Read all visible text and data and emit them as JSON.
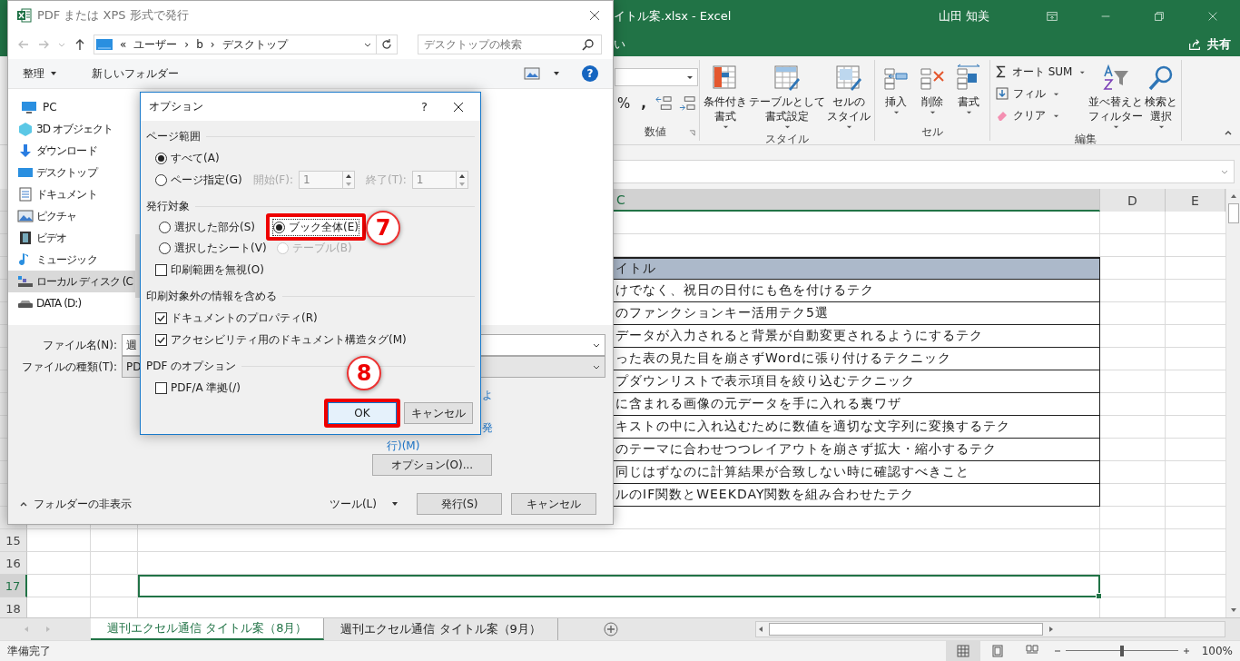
{
  "excel": {
    "title": "イトル案.xlsx  -  Excel",
    "user": "山田 知美",
    "tab_fragment": "い",
    "share": "共有",
    "ribbon": {
      "number_group": {
        "label": "数値",
        "percent": "%",
        "comma": ","
      },
      "style_group": {
        "label": "スタイル",
        "buttons": [
          {
            "lines": [
              "条件付き",
              "書式"
            ]
          },
          {
            "lines": [
              "テーブルとして",
              "書式設定"
            ]
          },
          {
            "lines": [
              "セルの",
              "スタイル"
            ]
          }
        ]
      },
      "cells_group": {
        "label": "セル",
        "buttons": [
          {
            "label": "挿入"
          },
          {
            "label": "削除"
          },
          {
            "label": "書式"
          }
        ]
      },
      "edit_group": {
        "label": "編集",
        "small_buttons": [
          {
            "label": "オート SUM"
          },
          {
            "label": "フィル"
          },
          {
            "label": "クリア"
          }
        ],
        "buttons": [
          {
            "lines": [
              "並べ替えと",
              "フィルター"
            ]
          },
          {
            "lines": [
              "検索と",
              "選択"
            ]
          }
        ]
      }
    },
    "columns": [
      {
        "label": "C",
        "selected": true
      },
      {
        "label": "D",
        "selected": false
      },
      {
        "label": "E",
        "selected": false
      }
    ],
    "rows": [
      {
        "kind": "blank",
        "selected": false
      },
      {
        "kind": "blank",
        "selected": false
      },
      {
        "kind": "header",
        "c": "イトル",
        "selected": false
      },
      {
        "kind": "data",
        "c": "けでなく、祝日の日付にも色を付けるテク",
        "selected": false
      },
      {
        "kind": "data",
        "c": "のファンクションキー活用テク5選",
        "selected": false
      },
      {
        "kind": "data",
        "c": "データが入力されると背景が自動変更されるようにするテク",
        "selected": false
      },
      {
        "kind": "data",
        "c": "った表の見た目を崩さずWordに張り付けるテクニック",
        "selected": false
      },
      {
        "kind": "data",
        "c": "プダウンリストで表示項目を絞り込むテクニック",
        "selected": false
      },
      {
        "kind": "data",
        "c": "に含まれる画像の元データを手に入れる裏ワザ",
        "selected": false
      },
      {
        "kind": "data",
        "c": "キストの中に入れ込むために数値を適切な文字列に変換するテク",
        "selected": false
      },
      {
        "kind": "data",
        "c": "のテーマに合わせつつレイアウトを崩さず拡大・縮小するテク",
        "selected": false
      },
      {
        "kind": "data",
        "c": "同じはずなのに計算結果が合致しない時に確認すべきこと",
        "selected": false
      },
      {
        "kind": "data",
        "c": "ルのIF関数とWEEKDAY関数を組み合わせたテク",
        "selected": false
      },
      {
        "kind": "blank",
        "selected": false
      },
      {
        "kind": "blank",
        "number": "15",
        "selected": false
      },
      {
        "kind": "blank",
        "number": "16",
        "selected": false
      },
      {
        "kind": "blank",
        "number": "17",
        "selected": true
      },
      {
        "kind": "blank",
        "number": "18",
        "selected": false
      }
    ],
    "sheet_tabs": [
      {
        "label": "週刊エクセル通信 タイトル案（8月）",
        "selected": true
      },
      {
        "label": "週刊エクセル通信 タイトル案（9月）",
        "selected": false
      }
    ],
    "status": "準備完了",
    "zoom": {
      "level": 0.5,
      "reading": "100%"
    }
  },
  "save_dialog": {
    "title": "PDF または XPS 形式で発行",
    "address": [
      "«",
      "ユーザー",
      "›",
      "b",
      "›",
      "デスクトップ"
    ],
    "search": {
      "placeholder": "デスクトップの検索"
    },
    "organize": "整理",
    "new_folder": "新しいフォルダー",
    "help": "?",
    "tree": [
      {
        "label": "PC",
        "selected": false,
        "children": [
          {
            "label": "3D オブジェクト",
            "selected": false
          },
          {
            "label": "ダウンロード",
            "selected": false
          },
          {
            "label": "デスクトップ",
            "selected": false
          },
          {
            "label": "ドキュメント",
            "selected": false
          },
          {
            "label": "ピクチャ",
            "selected": false
          },
          {
            "label": "ビデオ",
            "selected": false
          },
          {
            "label": "ミュージック",
            "selected": false
          },
          {
            "label": "ローカル ディスク (C",
            "selected": true
          },
          {
            "label": "DATA (D:)",
            "selected": false
          }
        ]
      }
    ],
    "file_name": {
      "label": "ファイル名(N):",
      "value": "週"
    },
    "file_type": {
      "label": "ファイルの種類(T):",
      "value": "PD"
    },
    "fragments": [
      "よ",
      "発",
      "行)(M)"
    ],
    "options_button": "オプション(O)...",
    "hide_folders": "フォルダーの非表示",
    "tools": "ツール(L)",
    "publish": "発行(S)",
    "cancel": "キャンセル"
  },
  "options_dialog": {
    "title": "オプション",
    "help": "?",
    "page_range": {
      "heading": "ページ範囲",
      "options": [
        {
          "label": "すべて(A)",
          "selected": true
        },
        {
          "label": "ページ指定(G)",
          "selected": false
        }
      ],
      "start": {
        "label": "開始(F):",
        "value": "1",
        "disabled": true
      },
      "end": {
        "label": "終了(T):",
        "value": "1",
        "disabled": true
      }
    },
    "publish_what": {
      "heading": "発行対象",
      "options": [
        {
          "label": "選択した部分(S)",
          "selected": false,
          "disabled": false,
          "highlighted": false
        },
        {
          "label": "ブック全体(E)",
          "selected": true,
          "disabled": false,
          "highlighted": true
        },
        {
          "label": "選択したシート(V)",
          "selected": false,
          "disabled": false,
          "highlighted": false
        },
        {
          "label": "テーブル(B)",
          "selected": false,
          "disabled": true,
          "highlighted": false
        }
      ],
      "ignore_print_area": {
        "label": "印刷範囲を無視(O)",
        "checked": false
      }
    },
    "include_info": {
      "heading": "印刷対象外の情報を含める",
      "items": [
        {
          "label": "ドキュメントのプロパティ(R)",
          "checked": true
        },
        {
          "label": "アクセシビリティ用のドキュメント構造タグ(M)",
          "checked": true
        }
      ]
    },
    "pdf_options": {
      "heading": "PDF のオプション",
      "items": [
        {
          "label": "PDF/A 準拠(/)",
          "checked": false
        }
      ]
    },
    "buttons": [
      {
        "label": "OK",
        "highlighted": true
      },
      {
        "label": "キャンセル",
        "highlighted": false
      }
    ],
    "callouts": [
      {
        "number": "7"
      },
      {
        "number": "8"
      }
    ]
  }
}
